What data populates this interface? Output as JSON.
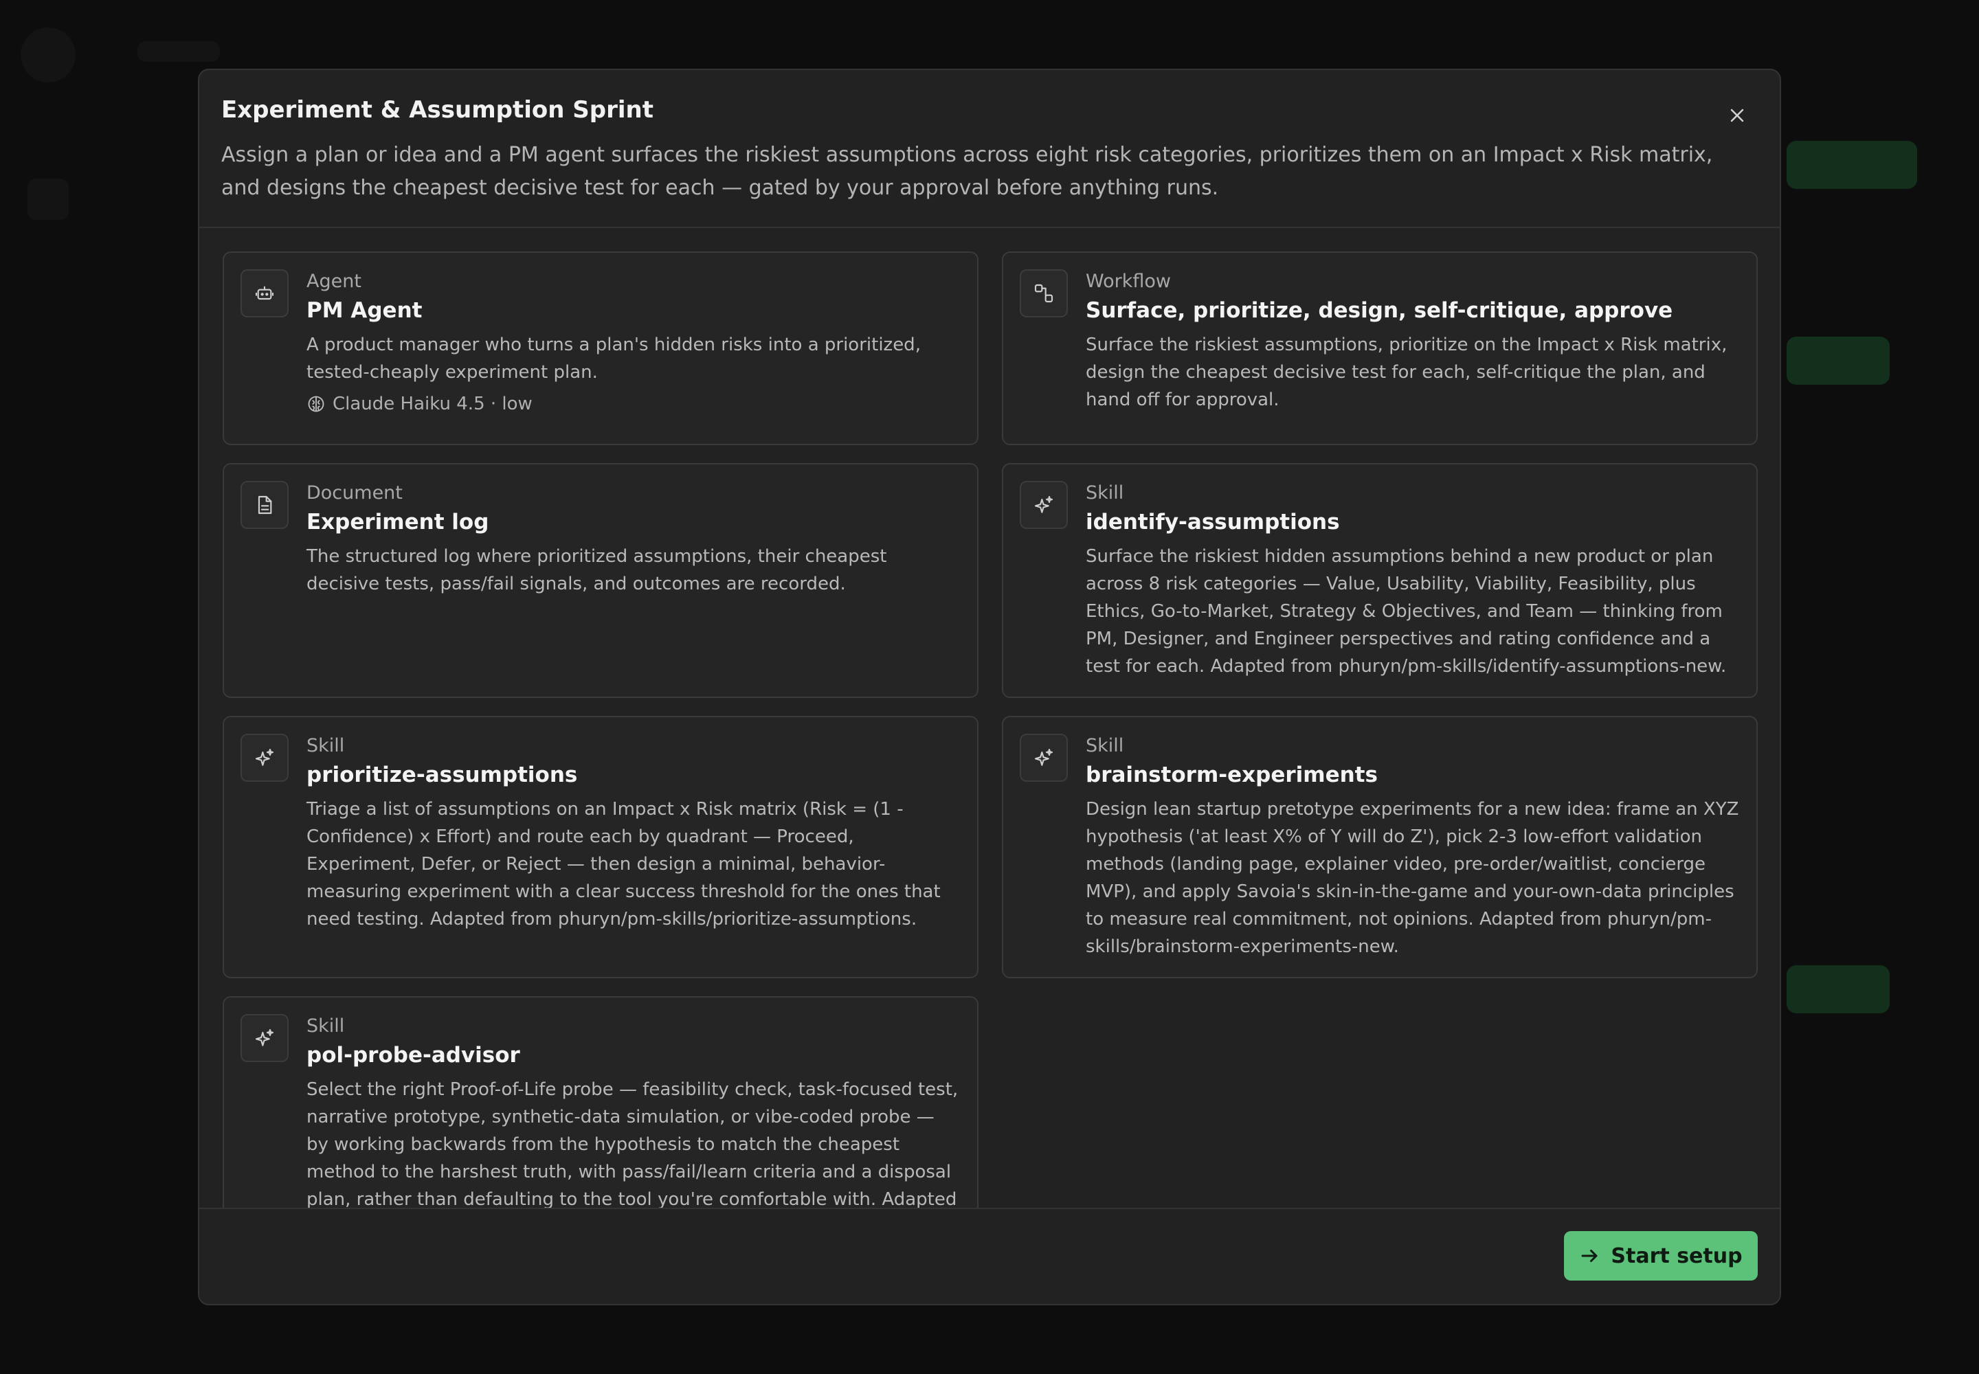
{
  "dialog": {
    "title": "Experiment & Assumption Sprint",
    "description": "Assign a plan or idea and a PM agent surfaces the riskiest assumptions across eight risk categories, prioritizes them on an Impact x Risk matrix, and designs the cheapest decisive test for each — gated by your approval before anything runs."
  },
  "cards": [
    {
      "type": "Agent",
      "title": "PM Agent",
      "text": "A product manager who turns a plan's hidden risks into a prioritized, tested-cheaply experiment plan.",
      "meta": "Claude Haiku 4.5 · low",
      "icon": "robot-icon"
    },
    {
      "type": "Workflow",
      "title": "Surface, prioritize, design, self-critique, approve",
      "text": "Surface the riskiest assumptions, prioritize on the Impact x Risk matrix, design the cheapest decisive test for each, self-critique the plan, and hand off for approval.",
      "icon": "workflow-icon"
    },
    {
      "type": "Document",
      "title": "Experiment log",
      "text": "The structured log where prioritized assumptions, their cheapest decisive tests, pass/fail signals, and outcomes are recorded.",
      "icon": "document-icon"
    },
    {
      "type": "Skill",
      "title": "identify-assumptions",
      "text": "Surface the riskiest hidden assumptions behind a new product or plan across 8 risk categories — Value, Usability, Viability, Feasibility, plus Ethics, Go-to-Market, Strategy & Objectives, and Team — thinking from PM, Designer, and Engineer perspectives and rating confidence and a test for each. Adapted from phuryn/pm-skills/identify-assumptions-new.",
      "icon": "sparkle-icon"
    },
    {
      "type": "Skill",
      "title": "prioritize-assumptions",
      "text": "Triage a list of assumptions on an Impact x Risk matrix (Risk = (1 - Confidence) x Effort) and route each by quadrant — Proceed, Experiment, Defer, or Reject — then design a minimal, behavior-measuring experiment with a clear success threshold for the ones that need testing. Adapted from phuryn/pm-skills/prioritize-assumptions.",
      "icon": "sparkle-icon"
    },
    {
      "type": "Skill",
      "title": "brainstorm-experiments",
      "text": "Design lean startup pretotype experiments for a new idea: frame an XYZ hypothesis ('at least X% of Y will do Z'), pick 2-3 low-effort validation methods (landing page, explainer video, pre-order/waitlist, concierge MVP), and apply Savoia's skin-in-the-game and your-own-data principles to measure real commitment, not opinions. Adapted from phuryn/pm-skills/brainstorm-experiments-new.",
      "icon": "sparkle-icon"
    },
    {
      "type": "Skill",
      "title": "pol-probe-advisor",
      "text": "Select the right Proof-of-Life probe — feasibility check, task-focused test, narrative prototype, synthetic-data simulation, or vibe-coded probe — by working backwards from the hypothesis to match the cheapest method to the harshest truth, with pass/fail/learn criteria and a disposal plan, rather than defaulting to the tool you're comfortable with. Adapted from",
      "icon": "sparkle-icon"
    }
  ],
  "footer": {
    "start_label": "Start setup"
  },
  "colors": {
    "accent": "#5cc27a",
    "modal_bg": "#222222",
    "card_bg": "#252525"
  }
}
